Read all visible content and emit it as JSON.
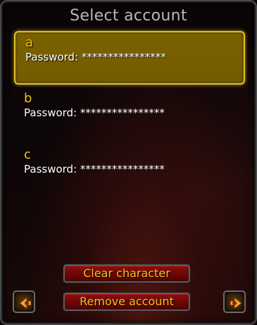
{
  "dialog": {
    "title": "Select account"
  },
  "accounts": [
    {
      "name": "a",
      "password_line": "Password: ****************"
    },
    {
      "name": "b",
      "password_line": "Password: ****************"
    },
    {
      "name": "c",
      "password_line": "Password: ****************"
    }
  ],
  "selected_index": 0,
  "buttons": {
    "clear_character": "Clear character",
    "remove_account": "Remove account"
  },
  "nav": {
    "prev_icon": "arrow-left-icon",
    "next_icon": "arrow-right-icon"
  },
  "colors": {
    "accent_gold": "#f2c21a",
    "selection_bg": "#735b00",
    "button_red": "#6c0606"
  }
}
